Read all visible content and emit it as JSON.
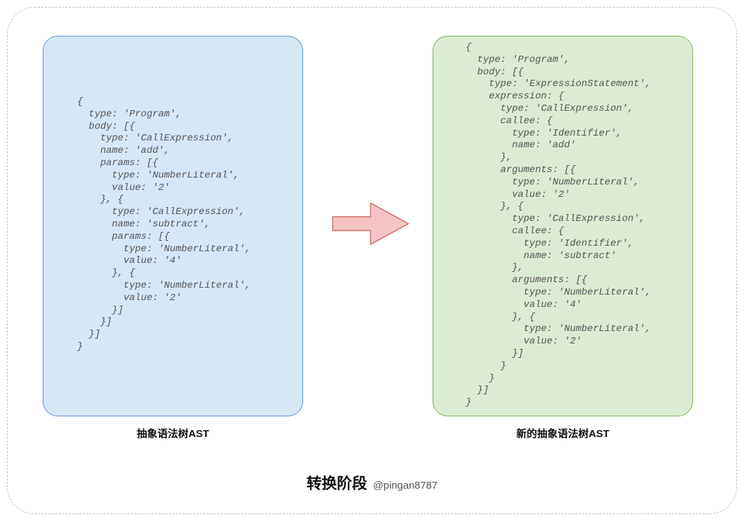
{
  "leftCode": "{\n  type: 'Program',\n  body: [{\n    type: 'CallExpression',\n    name: 'add',\n    params: [{\n      type: 'NumberLiteral',\n      value: '2'\n    }, {\n      type: 'CallExpression',\n      name: 'subtract',\n      params: [{\n        type: 'NumberLiteral',\n        value: '4'\n      }, {\n        type: 'NumberLiteral',\n        value: '2'\n      }]\n    }]\n  }]\n}",
  "rightCode": "{\n  type: 'Program',\n  body: [{\n    type: 'ExpressionStatement',\n    expression: {\n      type: 'CallExpression',\n      callee: {\n        type: 'Identifier',\n        name: 'add'\n      },\n      arguments: [{\n        type: 'NumberLiteral',\n        value: '2'\n      }, {\n        type: 'CallExpression',\n        callee: {\n          type: 'Identifier',\n          name: 'subtract'\n        },\n        arguments: [{\n          type: 'NumberLiteral',\n          value: '4'\n        }, {\n          type: 'NumberLiteral',\n          value: '2'\n        }]\n      }\n    }\n  }]\n}",
  "labels": {
    "left": "抽象语法树AST",
    "right": "新的抽象语法树AST"
  },
  "footer": {
    "title": "转换阶段",
    "author": "@pingan8787"
  },
  "colors": {
    "leftFill": "#d6e7f8",
    "leftStroke": "#5a92d6",
    "rightFill": "#dcecd4",
    "rightStroke": "#76b154",
    "arrowFill": "#f6c4c4",
    "arrowStroke": "#d46a66"
  }
}
